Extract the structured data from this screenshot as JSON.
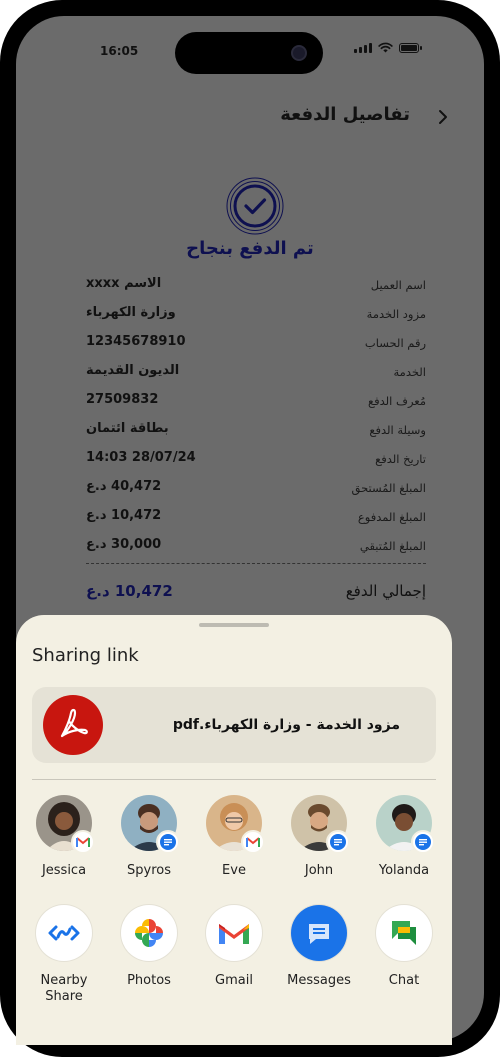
{
  "status_bar": {
    "time": "16:05"
  },
  "header": {
    "title": "تفاصيل الدفعة"
  },
  "success": {
    "text": "تم الدفع بنجاح"
  },
  "details": [
    {
      "label": "اسم العميل",
      "value": "الاسم xxxx"
    },
    {
      "label": "مزود الخدمة",
      "value": "وزارة الكهرباء"
    },
    {
      "label": "رقم الحساب",
      "value": "12345678910"
    },
    {
      "label": "الخدمة",
      "value": "الديون القديمة"
    },
    {
      "label": "مُعرف الدفع",
      "value": "27509832"
    },
    {
      "label": "وسيلة الدفع",
      "value": "بطاقة ائتمان"
    },
    {
      "label": "تاريخ الدفع",
      "value": "28/07/24 14:03"
    },
    {
      "label": "المبلغ المُستحق",
      "value": "40,472 د.ع"
    },
    {
      "label": "المبلغ المدفوع",
      "value": "10,472 د.ع"
    },
    {
      "label": "المبلغ المُتبقي",
      "value": "30,000 د.ع"
    }
  ],
  "total": {
    "label": "إجمالي الدفع",
    "value": "10,472 د.ع"
  },
  "share_sheet": {
    "title": "Sharing link",
    "file_name": "مزود الخدمة - وزارة الكهرباء.pdf",
    "contacts": [
      {
        "name": "Jessica",
        "badge": "gmail-icon"
      },
      {
        "name": "Spyros",
        "badge": "messages-icon"
      },
      {
        "name": "Eve",
        "badge": "gmail-icon"
      },
      {
        "name": "John",
        "badge": "messages-icon"
      },
      {
        "name": "Yolanda",
        "badge": "messages-icon"
      }
    ],
    "apps": [
      {
        "label": "Nearby Share",
        "icon": "nearby-share-icon"
      },
      {
        "label": "Photos",
        "icon": "photos-icon"
      },
      {
        "label": "Gmail",
        "icon": "gmail-icon"
      },
      {
        "label": "Messages",
        "icon": "messages-icon"
      },
      {
        "label": "Chat",
        "icon": "chat-icon"
      }
    ]
  },
  "colors": {
    "accent_navy": "#0e1050",
    "overlay": "#6b6b6b",
    "sheet": "#f3f0e3",
    "pdf_red": "#c8160f"
  }
}
